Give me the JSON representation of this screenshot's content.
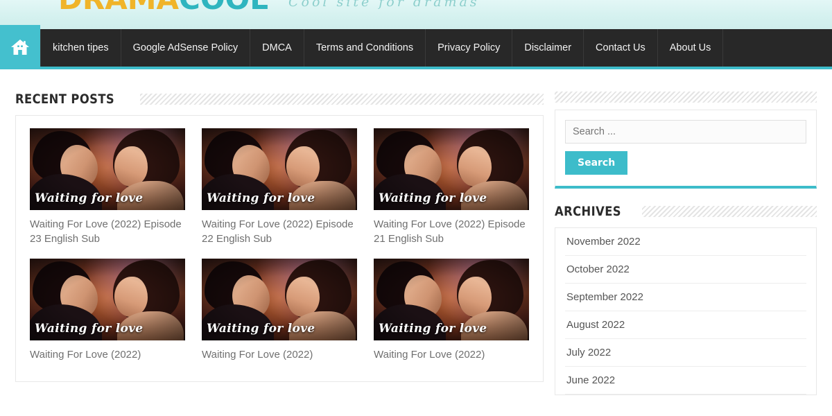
{
  "site": {
    "logo_part1": "DRAMA",
    "logo_part2": "COOL",
    "tagline": "Cool site for dramas"
  },
  "nav": {
    "home_icon": "home-icon",
    "items": [
      {
        "label": "kitchen tipes"
      },
      {
        "label": "Google AdSense Policy"
      },
      {
        "label": "DMCA"
      },
      {
        "label": "Terms and Conditions"
      },
      {
        "label": "Privacy Policy"
      },
      {
        "label": "Disclaimer"
      },
      {
        "label": "Contact Us"
      },
      {
        "label": "About Us"
      }
    ]
  },
  "main": {
    "heading": "Recent Posts",
    "posts": [
      {
        "caption": "Waiting for love",
        "title": "Waiting For Love (2022) Episode 23 English Sub"
      },
      {
        "caption": "Waiting for love",
        "title": "Waiting For Love (2022) Episode 22 English Sub"
      },
      {
        "caption": "Waiting for love",
        "title": "Waiting For Love (2022) Episode 21 English Sub"
      },
      {
        "caption": "Waiting for love",
        "title": "Waiting For Love (2022)"
      },
      {
        "caption": "Waiting for love",
        "title": "Waiting For Love (2022)"
      },
      {
        "caption": "Waiting for love",
        "title": "Waiting For Love (2022)"
      }
    ]
  },
  "sidebar": {
    "search": {
      "placeholder": "Search ...",
      "value": "",
      "button_label": "Search"
    },
    "archives": {
      "heading": "Archives",
      "items": [
        {
          "label": "November 2022"
        },
        {
          "label": "October 2022"
        },
        {
          "label": "September 2022"
        },
        {
          "label": "August 2022"
        },
        {
          "label": "July 2022"
        },
        {
          "label": "June 2022"
        }
      ]
    }
  },
  "colors": {
    "accent_teal": "#3dbcca",
    "nav_dark": "#282828",
    "logo_gold": "#f0b429",
    "header_bg": "#d4f1ef"
  }
}
